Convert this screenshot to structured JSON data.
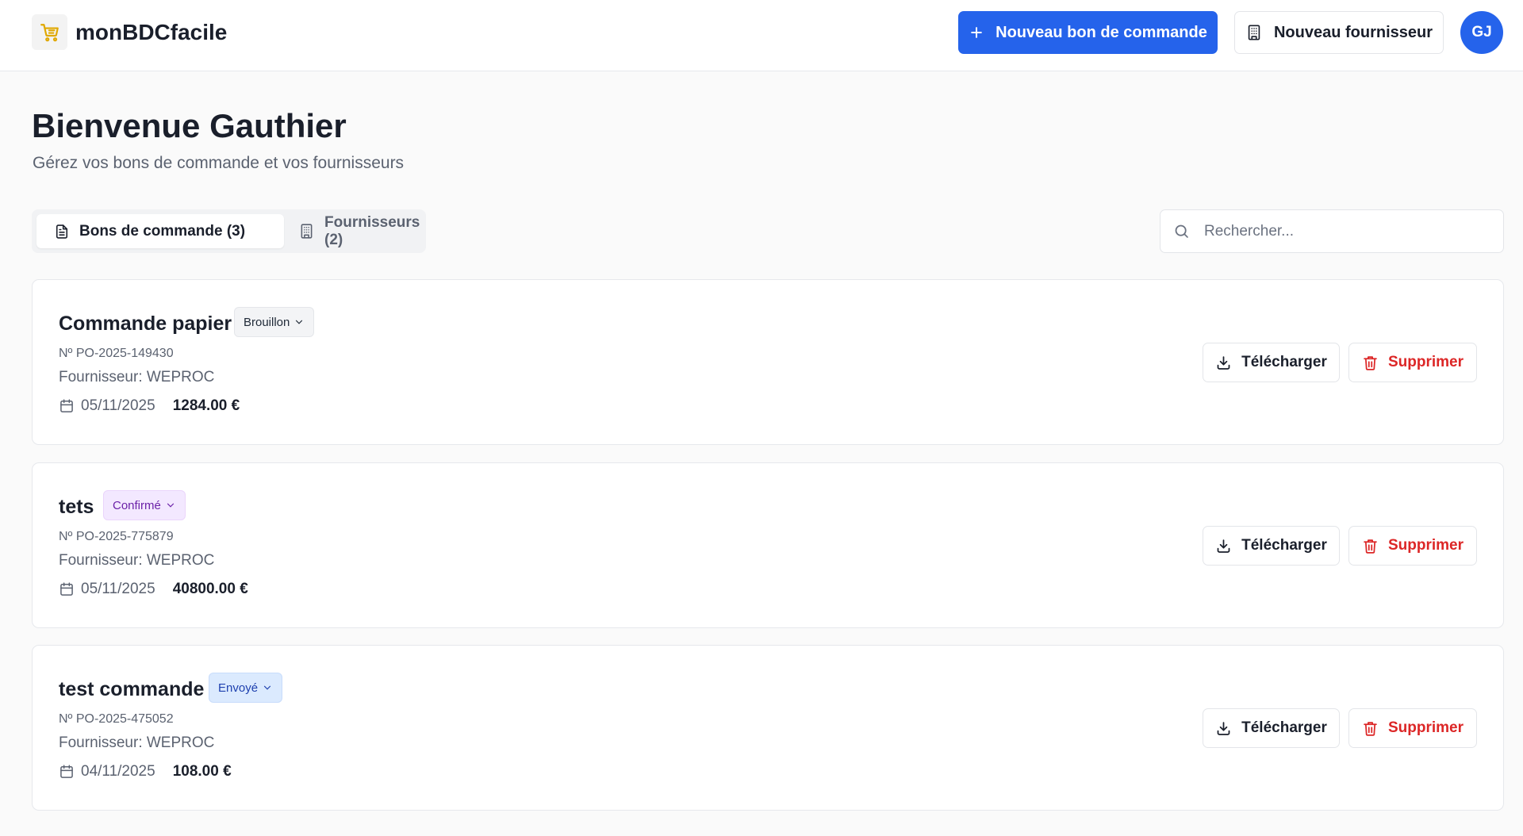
{
  "app": {
    "brand": "monBDCfacile",
    "logo_icon": "shopping-cart-icon",
    "new_order_label": "Nouveau bon de commande",
    "new_supplier_label": "Nouveau fournisseur",
    "avatar_initials": "GJ",
    "accent_color": "#2563eb"
  },
  "page": {
    "title": "Bienvenue Gauthier",
    "subtitle": "Gérez vos bons de commande et vos fournisseurs"
  },
  "tabs": [
    {
      "label": "Bons de commande (3)",
      "icon": "file-text-icon",
      "active": true
    },
    {
      "label": "Fournisseurs (2)",
      "icon": "building-icon",
      "active": false
    }
  ],
  "search": {
    "placeholder": "Rechercher...",
    "value": ""
  },
  "orders": [
    {
      "title": "Commande papier",
      "status": "Brouillon",
      "number": "Nº PO-2025-149430",
      "supplier": "Fournisseur: WEPROC",
      "date": "05/11/2025",
      "amount": "1284.00 €",
      "download_label": "Télécharger",
      "delete_label": "Supprimer"
    },
    {
      "title": "tets",
      "status": "Confirmé",
      "number": "Nº PO-2025-775879",
      "supplier": "Fournisseur: WEPROC",
      "date": "05/11/2025",
      "amount": "40800.00 €",
      "download_label": "Télécharger",
      "delete_label": "Supprimer"
    },
    {
      "title": "test commande",
      "status": "Envoyé",
      "number": "Nº PO-2025-475052",
      "supplier": "Fournisseur: WEPROC",
      "date": "04/11/2025",
      "amount": "108.00 €",
      "download_label": "Télécharger",
      "delete_label": "Supprimer"
    }
  ],
  "status_colors": {
    "Brouillon": "#f3f4f6",
    "Confirmé": "#f3e8ff",
    "Envoyé": "#dbeafe",
    "delete": "#dc2626"
  }
}
